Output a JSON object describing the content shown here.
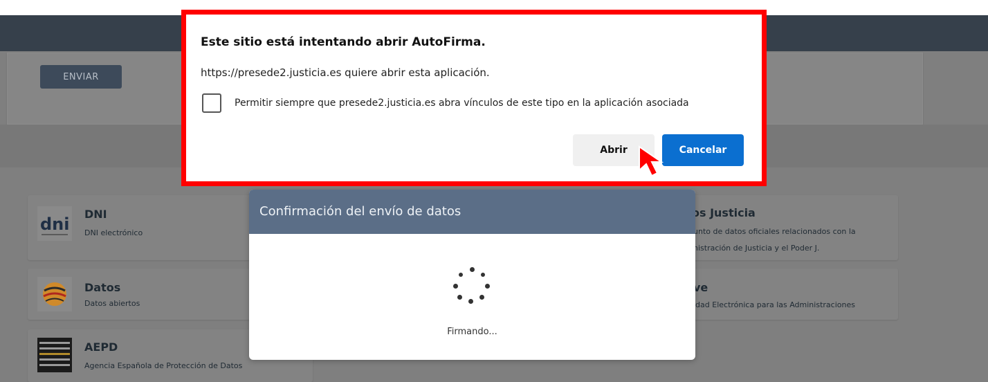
{
  "background_page": {
    "form": {
      "send_label": "ENVIAR"
    },
    "cards": [
      {
        "title": "DNI",
        "subtitle": "DNI electrónico",
        "logo_icon": "dni-logo"
      },
      {
        "title": "Datos",
        "subtitle": "Datos abiertos",
        "logo_icon": "datos-logo"
      },
      {
        "title": "AEPD",
        "subtitle": "Agencia Española de Protección de Datos",
        "logo_icon": "aepd-logo"
      }
    ],
    "right_cards": [
      {
        "title": "os Justicia",
        "subtitle_line1": "unto de datos oficiales relacionados con la",
        "subtitle_line2": "nistración de Justicia y el Poder J."
      },
      {
        "title": "ve",
        "subtitle": "idad Electrónica para las Administraciones"
      }
    ]
  },
  "loading_modal": {
    "title": "Confirmación del envío de datos",
    "status": "Firmando..."
  },
  "browser_dialog": {
    "title": "Este sitio está intentando abrir AutoFirma.",
    "message": "https://presede2.justicia.es quiere abrir esta aplicación.",
    "checkbox_label": "Permitir siempre que presede2.justicia.es abra vínculos de este tipo en la aplicación asociada",
    "checkbox_checked": false,
    "open_label": "Abrir",
    "cancel_label": "Cancelar",
    "highlight_color": "#ff0000",
    "cancel_color": "#0b6fd0"
  }
}
